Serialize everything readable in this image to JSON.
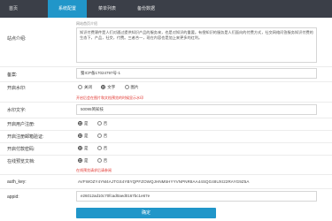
{
  "tabs": [
    {
      "label": "首页"
    },
    {
      "label": "系统配置"
    },
    {
      "label": "菜单列表"
    },
    {
      "label": "备份数据"
    }
  ],
  "form": {
    "top_hint": "网站首页介绍",
    "intro": {
      "label": "站点介绍:",
      "value": "知识付费课件是人们对通过提供知识产品的服务来，也是对知识的重要。有偿知识的服务是人们面向的付费方式，社交网络问答服务知识付费的生态下，产品，社交，付费。三者合一，现在内容也是加上来更多的红利。"
    },
    "icp": {
      "label": "备案:",
      "value": "蜀ICP备17024797号-1"
    },
    "watermark": {
      "label": "开启水印:",
      "options": [
        "关闭",
        "文字",
        "图片"
      ],
      "hint": "开启后会在图片和文档预览的时候显示水印"
    },
    "watermark_text": {
      "label": "水印文字:",
      "value": "50095简知技"
    },
    "user_register": {
      "label": "开启用户注册:",
      "options": [
        "是",
        "否"
      ]
    },
    "register_verify": {
      "label": "开启注册邮箱验证:",
      "options": [
        "是",
        "否"
      ]
    },
    "pay_verify": {
      "label": "开启付款密码:",
      "options": [
        "是",
        "否"
      ]
    },
    "online_preview": {
      "label": "在线预览文档:",
      "options": [
        "是",
        "否"
      ],
      "hint": "在线预览请求后请参阅"
    },
    "auth_key": {
      "label": "auth_key:",
      "value": "AVFWOZY4YM4AJTGS4YBYQPFZOWQJHNM5HYYVNPNR8AA44SQG48UXI22RAYG9Z5A"
    },
    "appid": {
      "label": "appid:",
      "value": "e26012ad10c70fcad0aed0167bc1e67e"
    },
    "submit_label": "确定"
  },
  "colors": {
    "topbar": "#3b3f48",
    "accent": "#2196c9",
    "hint_red": "#e0312b"
  }
}
